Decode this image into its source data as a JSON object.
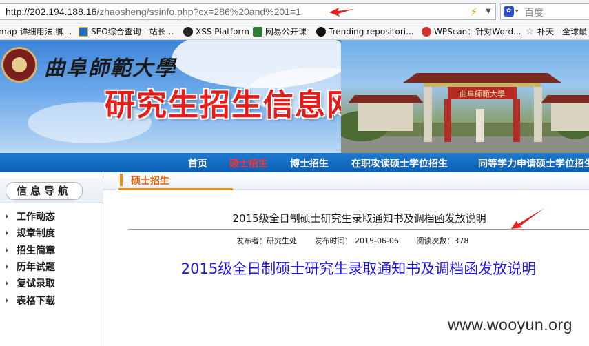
{
  "browser": {
    "url_host": "http://202.194.188.16",
    "url_rest": "/zhaosheng/ssinfo.php?cx=286%20and%201=1",
    "search_placeholder": "百度"
  },
  "bookmarks": [
    {
      "label": "map 详细用法-脚...",
      "icon": "folder-icon",
      "color": "#f0c040"
    },
    {
      "label": "SEO综合查询 - 站长...",
      "icon": "chinaz-icon",
      "color": "#1f6fc9"
    },
    {
      "label": "XSS Platform",
      "icon": "skull-icon",
      "color": "#222222"
    },
    {
      "label": "网易公开课",
      "icon": "play-icon",
      "color": "#2e7d32"
    },
    {
      "label": "Trending repositori...",
      "icon": "github-icon",
      "color": "#111111"
    },
    {
      "label": "WPScan：针对Word...",
      "icon": "wpscan-icon",
      "color": "#d32f2f"
    },
    {
      "label": "补天 - 全球最",
      "icon": "star-icon",
      "color": "#888888"
    }
  ],
  "banner": {
    "school_name": "曲阜師範大學",
    "site_title": "研究生招生信息网",
    "gate_sign": "曲阜師範大學"
  },
  "nav": {
    "items": [
      {
        "label": "首页",
        "active": false
      },
      {
        "label": "硕士招生",
        "active": true
      },
      {
        "label": "博士招生",
        "active": false
      },
      {
        "label": "在职攻读硕士学位招生",
        "active": false
      },
      {
        "label": "同等学力申请硕士学位招生",
        "active": false
      }
    ]
  },
  "sidebar": {
    "title": "信息导航",
    "items": [
      "工作动态",
      "规章制度",
      "招生简章",
      "历年试题",
      "复试录取",
      "表格下载"
    ]
  },
  "content": {
    "section_title": "硕士招生",
    "article_title": "2015级全日制硕士研究生录取通知书及调档函发放说明",
    "publisher": "发布者：研究生处",
    "publish_time": "发布时间： 2015-06-06",
    "read_count": "阅读次数：378",
    "big_title": "2015级全日制硕士研究生录取通知书及调档函发放说明"
  },
  "watermark": "www.wooyun.org",
  "colors": {
    "nav_bg": "#0d5fb3",
    "nav_active": "#ff3030",
    "section_accent": "#f08a14",
    "site_title": "#e81b1b",
    "big_title": "#1d16e0"
  }
}
